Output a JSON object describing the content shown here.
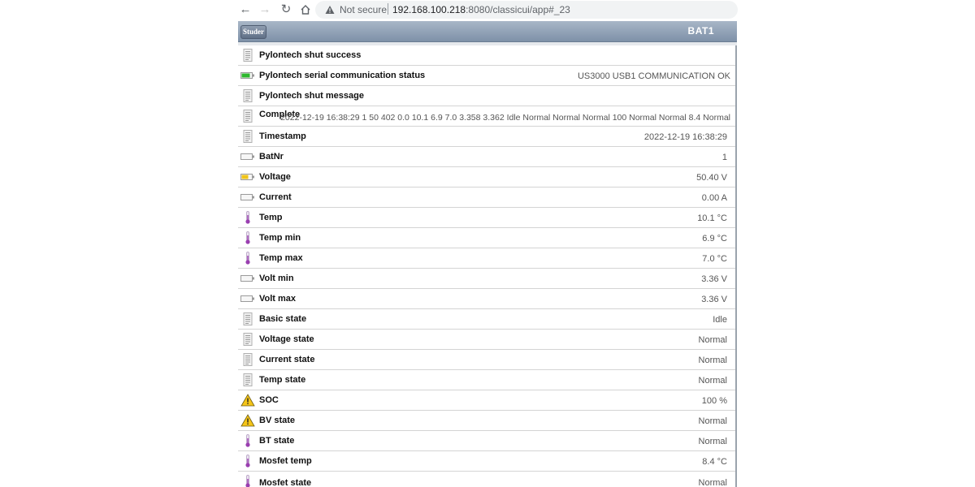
{
  "browser": {
    "security_label": "Not secure",
    "url_host": "192.168.100.218",
    "url_path": ":8080/classicui/app#_23"
  },
  "header": {
    "brand_label": "Studer",
    "title": "BAT1",
    "colors": {
      "header_top": "#a8b6c7",
      "header_bottom": "#7e91a8"
    }
  },
  "items": [
    {
      "label": "Pylontech shut success",
      "value": "",
      "icon": "text-icon"
    },
    {
      "label": "Pylontech serial communication status",
      "value": "US3000 USB1 COMMUNICATION OK",
      "icon": "battery-green-icon"
    },
    {
      "label": "Pylontech shut message",
      "value": "",
      "icon": "text-icon"
    },
    {
      "label": "Complete",
      "value": "2022-12-19 16:38:29 1 50 402 0.0 10.1 6.9 7.0 3.358 3.362 Idle Normal Normal Normal 100 Normal Normal 8.4 Normal",
      "icon": "text-icon"
    },
    {
      "label": "Timestamp",
      "value": "2022-12-19 16:38:29",
      "icon": "text-icon"
    },
    {
      "label": "BatNr",
      "value": "1",
      "icon": "battery-empty-icon"
    },
    {
      "label": "Voltage",
      "value": "50.40 V",
      "icon": "battery-yellow-icon"
    },
    {
      "label": "Current",
      "value": "0.00 A",
      "icon": "battery-empty-icon"
    },
    {
      "label": "Temp",
      "value": "10.1 °C",
      "icon": "thermometer-icon"
    },
    {
      "label": "Temp min",
      "value": "6.9 °C",
      "icon": "thermometer-icon"
    },
    {
      "label": "Temp max",
      "value": "7.0 °C",
      "icon": "thermometer-icon"
    },
    {
      "label": "Volt min",
      "value": "3.36 V",
      "icon": "battery-empty-icon"
    },
    {
      "label": "Volt max",
      "value": "3.36 V",
      "icon": "battery-empty-icon"
    },
    {
      "label": "Basic state",
      "value": "Idle",
      "icon": "text-icon"
    },
    {
      "label": "Voltage state",
      "value": "Normal",
      "icon": "text-icon"
    },
    {
      "label": "Current state",
      "value": "Normal",
      "icon": "text-icon"
    },
    {
      "label": "Temp state",
      "value": "Normal",
      "icon": "text-icon"
    },
    {
      "label": "SOC",
      "value": "100 %",
      "icon": "warning-icon"
    },
    {
      "label": "BV state",
      "value": "Normal",
      "icon": "warning-icon"
    },
    {
      "label": "BT state",
      "value": "Normal",
      "icon": "thermometer-icon"
    },
    {
      "label": "Mosfet temp",
      "value": "8.4 °C",
      "icon": "thermometer-icon"
    },
    {
      "label": "Mosfet state",
      "value": "Normal",
      "icon": "thermometer-icon"
    }
  ]
}
